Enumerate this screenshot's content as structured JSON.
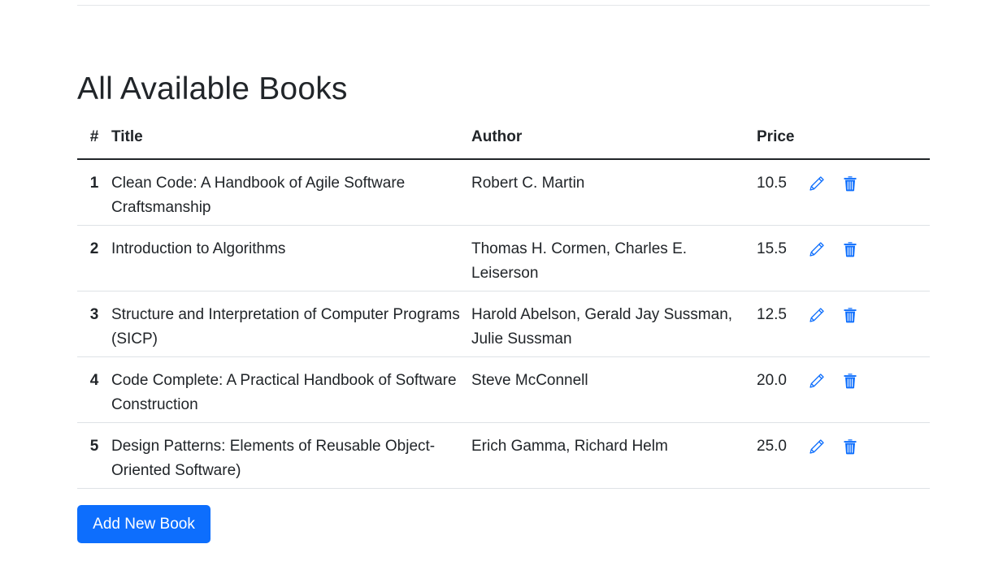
{
  "page": {
    "title": "All Available Books"
  },
  "table": {
    "headers": {
      "num": "#",
      "title": "Title",
      "author": "Author",
      "price": "Price"
    },
    "rows": [
      {
        "num": "1",
        "title": "Clean Code: A Handbook of Agile Software Craftsmanship",
        "author": "Robert C. Martin",
        "price": "10.5"
      },
      {
        "num": "2",
        "title": "Introduction to Algorithms",
        "author": "Thomas H. Cormen, Charles E. Leiserson",
        "price": "15.5"
      },
      {
        "num": "3",
        "title": "Structure and Interpretation of Computer Programs (SICP)",
        "author": "Harold Abelson, Gerald Jay Sussman, Julie Sussman",
        "price": "12.5"
      },
      {
        "num": "4",
        "title": "Code Complete: A Practical Handbook of Software Construction",
        "author": "Steve McConnell",
        "price": "20.0"
      },
      {
        "num": "5",
        "title": "Design Patterns: Elements of Reusable Object-Oriented Software)",
        "author": "Erich Gamma, Richard Helm",
        "price": "25.0"
      }
    ],
    "row_actions": {
      "edit_icon": "pencil-icon",
      "delete_icon": "trash-icon"
    }
  },
  "add_button": {
    "label": "Add New Book"
  },
  "colors": {
    "primary": "#0d6efd",
    "text": "#212529",
    "row_border": "#dee2e6"
  }
}
